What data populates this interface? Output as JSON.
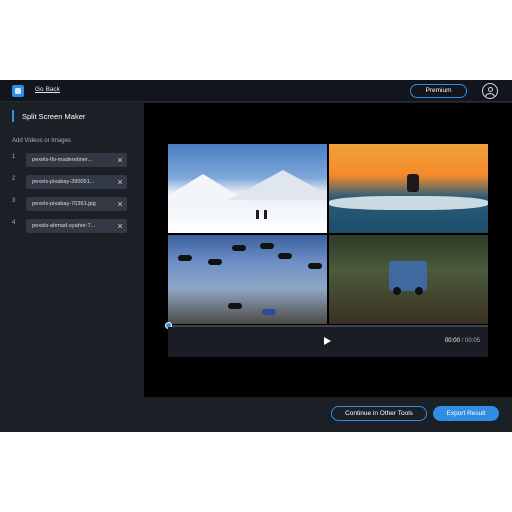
{
  "header": {
    "go_back_label": "Go Back",
    "premium_label": "Premium"
  },
  "sidebar": {
    "title": "Split Screen Maker",
    "section_label": "Add Videos or Images",
    "items": [
      {
        "num": "1",
        "file": "pexels-flo-maderebner..."
      },
      {
        "num": "2",
        "file": "pexels-pixabay-390051..."
      },
      {
        "num": "3",
        "file": "pexels-pixabay-70361.jpg"
      },
      {
        "num": "4",
        "file": "pexels-ahmad-syahrir-7..."
      }
    ],
    "remove_icon": "close-icon"
  },
  "player": {
    "current_time": "00:00",
    "separator": " / ",
    "total_time": "00:05",
    "progress": 0
  },
  "footer": {
    "continue_label": "Continue in Other Tools",
    "export_label": "Export Result"
  },
  "colors": {
    "accent": "#2f8de4",
    "panel": "#1b1f26",
    "preview_bg": "#000000"
  }
}
